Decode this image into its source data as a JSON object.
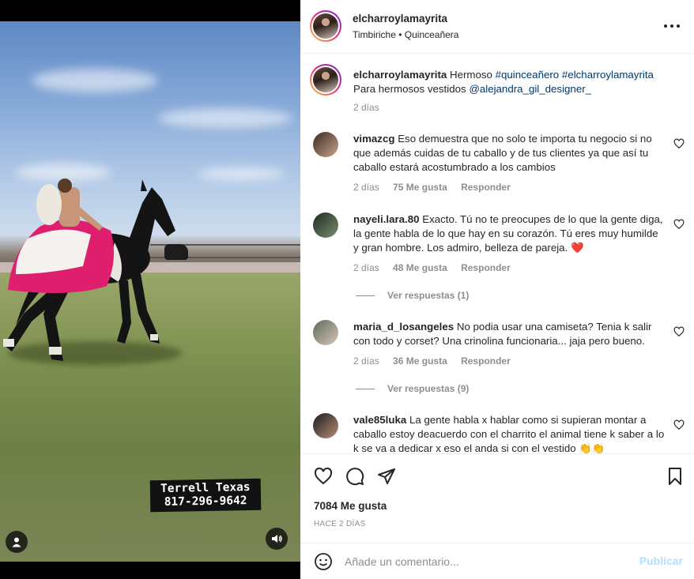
{
  "post": {
    "author": "elcharroylamayrita",
    "location_line": "Timbiriche • Quinceañera",
    "caption_prefix": "Hermoso ",
    "caption_tag1": "#quinceañero",
    "caption_tag2": "#elcharroylamayrita",
    "caption_line2_prefix": "Para hermosos vestidos ",
    "caption_mention": "@alejandra_gil_designer_",
    "caption_time": "2 días"
  },
  "media": {
    "watermark_line1": "Terrell Texas",
    "watermark_line2": "817-296-9642"
  },
  "comments": [
    {
      "user": "vimazcg",
      "text": "Eso demuestra que no solo te importa tu negocio si no que además cuidas de tu caballo y de tus clientes ya que así tu caballo estará acostumbrado a los cambios",
      "time": "2 días",
      "likes": "75 Me gusta",
      "reply": "Responder"
    },
    {
      "user": "nayeli.lara.80",
      "text": "Exacto. Tú no te preocupes de lo que la gente diga, la gente habla de lo que hay en su corazón. Tú eres muy humilde y gran hombre. Los admiro, belleza de pareja. ❤️",
      "time": "2 días",
      "likes": "48 Me gusta",
      "reply": "Responder",
      "view_replies": "Ver respuestas (1)"
    },
    {
      "user": "maria_d_losangeles",
      "text": "No podia usar una camiseta? Tenia k salir con todo y corset? Una crinolina funcionaria... jaja pero bueno.",
      "time": "2 días",
      "likes": "36 Me gusta",
      "reply": "Responder",
      "view_replies": "Ver respuestas (9)"
    },
    {
      "user": "vale85luka",
      "text": "La gente habla x hablar como si supieran montar a caballo estoy deacuerdo con el charrito el animal tiene k saber a lo k se va a dedicar x eso el anda si con el vestido 👏👏"
    }
  ],
  "actions": {
    "likes_count": "7084 Me gusta",
    "posted_ago": "HACE 2 DÍAS"
  },
  "composer": {
    "placeholder": "Añade un comentario...",
    "publish_label": "Publicar"
  },
  "colors": {
    "link": "#00376b",
    "muted": "#8e8e8e",
    "publish_disabled": "#b2dffc",
    "heart_red": "#ed1c24"
  }
}
